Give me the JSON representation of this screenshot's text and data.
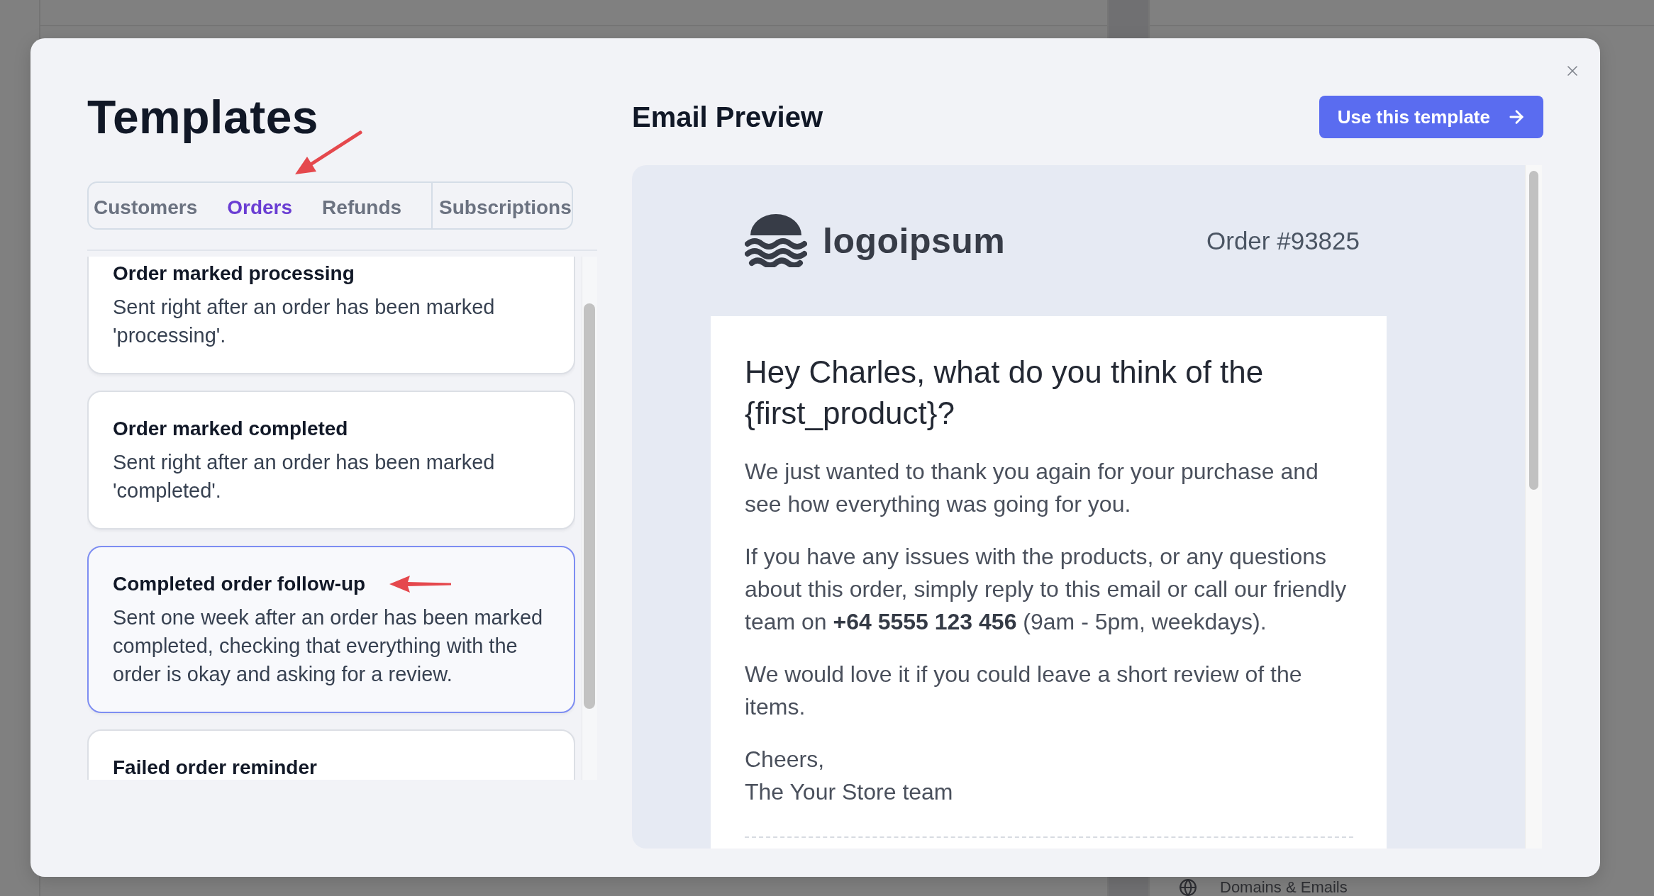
{
  "backdrop": {
    "nav_item": "Domains & Emails"
  },
  "dialog": {
    "title": "Templates",
    "tabs": [
      {
        "label": "Customers",
        "selected": false
      },
      {
        "label": "Orders",
        "selected": true
      },
      {
        "label": "Refunds",
        "selected": false
      },
      {
        "label": "Subscriptions",
        "selected": false
      }
    ],
    "templates": [
      {
        "title": "Order marked processing",
        "description": "Sent right after an order has been marked 'processing'.",
        "selected": false
      },
      {
        "title": "Order marked completed",
        "description": "Sent right after an order has been marked 'completed'.",
        "selected": false
      },
      {
        "title": "Completed order follow-up",
        "description": "Sent one week after an order has been marked completed, checking that everything with the order is okay and asking for a review.",
        "selected": true
      },
      {
        "title": "Failed order reminder",
        "selected": false
      }
    ],
    "preview": {
      "title": "Email Preview",
      "action_button": "Use this template",
      "email": {
        "brand": "logoipsum",
        "order_number": "Order #93825",
        "heading": "Hey Charles, what do you think of the {first_product}?",
        "paragraphs": [
          "We just wanted to thank you again for your purchase and see how everything was going for you.",
          "If you have any issues with the products, or any questions about this order, simply reply to this email or call our friendly team on **+64 5555 123 456** (9am - 5pm, weekdays).",
          "We would love it if you could leave a short review of the items."
        ],
        "sign_off": [
          "Cheers,",
          "The Your Store team"
        ]
      }
    }
  }
}
